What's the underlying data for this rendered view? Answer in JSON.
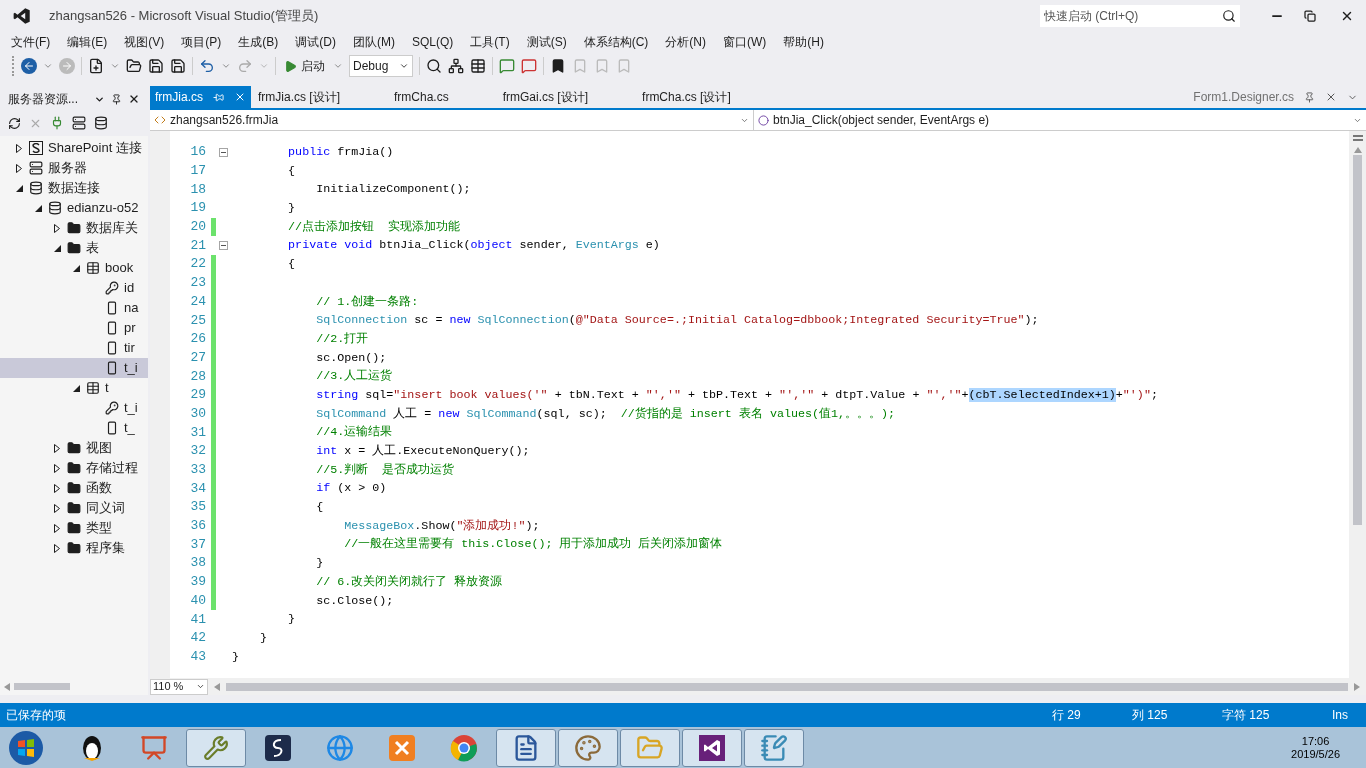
{
  "window": {
    "title": "zhangsan526 - Microsoft Visual Studio(管理员)",
    "quick_launch": {
      "placeholder": "快速启动 (Ctrl+Q)"
    }
  },
  "menu": [
    "文件(F)",
    "编辑(E)",
    "视图(V)",
    "项目(P)",
    "生成(B)",
    "调试(D)",
    "团队(M)",
    "SQL(Q)",
    "工具(T)",
    "测试(S)",
    "体系结构(C)",
    "分析(N)",
    "窗口(W)",
    "帮助(H)"
  ],
  "toolbar": {
    "start_label": "启动",
    "config": "Debug"
  },
  "server_explorer": {
    "title": "服务器资源...",
    "tree": [
      {
        "label": "SharePoint 连接",
        "kind": "sharepoint",
        "expanded": false,
        "selected": false
      },
      {
        "label": "服务器",
        "kind": "server",
        "expanded": false,
        "selected": false
      },
      {
        "label": "数据连接",
        "kind": "dbconn",
        "expanded": true,
        "selected": false,
        "children": [
          {
            "label": "edianzu-o52",
            "kind": "db",
            "expanded": true,
            "selected": false,
            "children": [
              {
                "label": "数据库关",
                "kind": "folder",
                "expanded": false,
                "selected": false
              },
              {
                "label": "表",
                "kind": "folder",
                "expanded": true,
                "selected": false,
                "children": [
                  {
                    "label": "book",
                    "kind": "table",
                    "expanded": true,
                    "selected": false,
                    "children": [
                      {
                        "label": "id",
                        "kind": "key",
                        "selected": false
                      },
                      {
                        "label": "na",
                        "kind": "column",
                        "selected": false
                      },
                      {
                        "label": "pr",
                        "kind": "column",
                        "selected": false
                      },
                      {
                        "label": "tir",
                        "kind": "column",
                        "selected": false
                      },
                      {
                        "label": "t_i",
                        "kind": "column",
                        "selected": true
                      }
                    ]
                  },
                  {
                    "label": "t",
                    "kind": "table",
                    "expanded": true,
                    "selected": false,
                    "children": [
                      {
                        "label": "t_i",
                        "kind": "key",
                        "selected": false
                      },
                      {
                        "label": "t_",
                        "kind": "column",
                        "selected": false
                      }
                    ]
                  }
                ]
              },
              {
                "label": "视图",
                "kind": "folder",
                "expanded": false,
                "selected": false
              },
              {
                "label": "存储过程",
                "kind": "folder",
                "expanded": false,
                "selected": false
              },
              {
                "label": "函数",
                "kind": "folder",
                "expanded": false,
                "selected": false
              },
              {
                "label": "同义词",
                "kind": "folder",
                "expanded": false,
                "selected": false
              },
              {
                "label": "类型",
                "kind": "folder",
                "expanded": false,
                "selected": false
              },
              {
                "label": "程序集",
                "kind": "folder",
                "expanded": false,
                "selected": false
              }
            ]
          }
        ]
      }
    ]
  },
  "tabs": [
    {
      "label": "frmJia.cs",
      "selected": true
    },
    {
      "label": "frmJia.cs [设计]",
      "selected": false
    },
    {
      "label": "frmCha.cs",
      "selected": false
    },
    {
      "label": "frmGai.cs [设计]",
      "selected": false
    },
    {
      "label": "frmCha.cs [设计]",
      "selected": false
    }
  ],
  "preview_tab": "Form1.Designer.cs",
  "nav": {
    "class": "zhangsan526.frmJia",
    "member": "btnJia_Click(object sender, EventArgs e)"
  },
  "code": [
    {
      "n": "16",
      "collapsible": true,
      "changed": false,
      "tokens": [
        {
          "kind": "keyword",
          "text": "        public"
        },
        {
          "kind": "plain",
          "text": " frmJia()"
        }
      ]
    },
    {
      "n": "17",
      "collapsible": false,
      "changed": false,
      "tokens": [
        {
          "kind": "plain",
          "text": "        {"
        }
      ]
    },
    {
      "n": "18",
      "collapsible": false,
      "changed": false,
      "tokens": [
        {
          "kind": "plain",
          "text": "            InitializeComponent();"
        }
      ]
    },
    {
      "n": "19",
      "collapsible": false,
      "changed": false,
      "tokens": [
        {
          "kind": "plain",
          "text": "        }"
        }
      ]
    },
    {
      "n": "20",
      "collapsible": false,
      "changed": true,
      "tokens": [
        {
          "kind": "comment",
          "text": "        //点击添加按钮  实现添加功能"
        }
      ]
    },
    {
      "n": "21",
      "collapsible": true,
      "changed": false,
      "tokens": [
        {
          "kind": "keyword",
          "text": "        private void"
        },
        {
          "kind": "plain",
          "text": " btnJia_Click("
        },
        {
          "kind": "keyword",
          "text": "object"
        },
        {
          "kind": "plain",
          "text": " sender,"
        },
        {
          "kind": "type",
          "text": " EventArgs"
        },
        {
          "kind": "plain",
          "text": " e)"
        }
      ]
    },
    {
      "n": "22",
      "collapsible": false,
      "changed": true,
      "tokens": [
        {
          "kind": "plain",
          "text": "        {"
        }
      ]
    },
    {
      "n": "23",
      "collapsible": false,
      "changed": true
    },
    {
      "n": "24",
      "collapsible": false,
      "changed": true,
      "tokens": [
        {
          "kind": "comment",
          "text": "            // 1.创建一条路:"
        }
      ]
    },
    {
      "n": "25",
      "collapsible": false,
      "changed": true,
      "tokens": [
        {
          "kind": "type",
          "text": "            SqlConnection"
        },
        {
          "kind": "plain",
          "text": " sc ="
        },
        {
          "kind": "keyword",
          "text": " new"
        },
        {
          "kind": "type",
          "text": " SqlConnection"
        },
        {
          "kind": "plain",
          "text": "("
        },
        {
          "kind": "string",
          "text": "@\"Data Source=.;Initial Catalog=dbbook;Integrated Security=True\""
        },
        {
          "kind": "plain",
          "text": ");"
        }
      ]
    },
    {
      "n": "26",
      "collapsible": false,
      "changed": true,
      "tokens": [
        {
          "kind": "comment",
          "text": "            //2.打开"
        }
      ]
    },
    {
      "n": "27",
      "collapsible": false,
      "changed": true,
      "tokens": [
        {
          "kind": "plain",
          "text": "            sc.Open();"
        }
      ]
    },
    {
      "n": "28",
      "collapsible": false,
      "changed": true,
      "tokens": [
        {
          "kind": "comment",
          "text": "            //3.人工运货"
        }
      ]
    },
    {
      "n": "29",
      "collapsible": false,
      "changed": true,
      "tokens": [
        {
          "kind": "keyword",
          "text": "            string"
        },
        {
          "kind": "plain",
          "text": " sql="
        },
        {
          "kind": "string",
          "text": "\"insert book values('\""
        },
        {
          "kind": "plain",
          "text": " + tbN.Text +"
        },
        {
          "kind": "string",
          "text": " \"','\""
        },
        {
          "kind": "plain",
          "text": " + tbP.Text +"
        },
        {
          "kind": "string",
          "text": " \"','\""
        },
        {
          "kind": "plain",
          "text": " + dtpT.Value +"
        },
        {
          "kind": "string",
          "text": " \"','\""
        },
        {
          "kind": "plain",
          "text": "+"
        },
        {
          "kind": "selection",
          "text": "(cbT.SelectedIndex+1)"
        },
        {
          "kind": "plain",
          "text": "+"
        },
        {
          "kind": "string",
          "text": "\"')\""
        },
        {
          "kind": "plain",
          "text": ";"
        }
      ]
    },
    {
      "n": "30",
      "collapsible": false,
      "changed": true,
      "tokens": [
        {
          "kind": "type",
          "text": "            SqlCommand"
        },
        {
          "kind": "plain",
          "text": " 人工 ="
        },
        {
          "kind": "keyword",
          "text": " new"
        },
        {
          "kind": "type",
          "text": " SqlCommand"
        },
        {
          "kind": "plain",
          "text": "(sql, sc);"
        },
        {
          "kind": "comment",
          "text": "  //货指的是 insert 表名 values(值1,。。。);"
        }
      ]
    },
    {
      "n": "31",
      "collapsible": false,
      "changed": true,
      "tokens": [
        {
          "kind": "comment",
          "text": "            //4.运输结果"
        }
      ]
    },
    {
      "n": "32",
      "collapsible": false,
      "changed": true,
      "tokens": [
        {
          "kind": "keyword",
          "text": "            int"
        },
        {
          "kind": "plain",
          "text": " x = 人工.ExecuteNonQuery();"
        }
      ]
    },
    {
      "n": "33",
      "collapsible": false,
      "changed": true,
      "tokens": [
        {
          "kind": "comment",
          "text": "            //5.判断  是否成功运货"
        }
      ]
    },
    {
      "n": "34",
      "collapsible": false,
      "changed": true,
      "tokens": [
        {
          "kind": "keyword",
          "text": "            if"
        },
        {
          "kind": "plain",
          "text": " (x > 0)"
        }
      ]
    },
    {
      "n": "35",
      "collapsible": false,
      "changed": true,
      "tokens": [
        {
          "kind": "plain",
          "text": "            {"
        }
      ]
    },
    {
      "n": "36",
      "collapsible": false,
      "changed": true,
      "tokens": [
        {
          "kind": "type",
          "text": "                MessageBox"
        },
        {
          "kind": "plain",
          "text": ".Show("
        },
        {
          "kind": "string",
          "text": "\"添加成功!\""
        },
        {
          "kind": "plain",
          "text": ");"
        }
      ]
    },
    {
      "n": "37",
      "collapsible": false,
      "changed": true,
      "tokens": [
        {
          "kind": "comment",
          "text": "                //一般在这里需要有 this.Close(); 用于添加成功 后关闭添加窗体"
        }
      ]
    },
    {
      "n": "38",
      "collapsible": false,
      "changed": true,
      "tokens": [
        {
          "kind": "plain",
          "text": "            }"
        }
      ]
    },
    {
      "n": "39",
      "collapsible": false,
      "changed": true,
      "tokens": [
        {
          "kind": "comment",
          "text": "            // 6.改关闭关闭就行了 释放资源"
        }
      ]
    },
    {
      "n": "40",
      "collapsible": false,
      "changed": true,
      "tokens": [
        {
          "kind": "plain",
          "text": "            sc.Close();"
        }
      ]
    },
    {
      "n": "41",
      "collapsible": false,
      "changed": false,
      "tokens": [
        {
          "kind": "plain",
          "text": "        }"
        }
      ]
    },
    {
      "n": "42",
      "collapsible": false,
      "changed": false,
      "tokens": [
        {
          "kind": "plain",
          "text": "    }"
        }
      ]
    },
    {
      "n": "43",
      "collapsible": false,
      "changed": false,
      "tokens": [
        {
          "kind": "plain",
          "text": "}"
        }
      ]
    }
  ],
  "zoom": "110 %",
  "status_bar": {
    "message": "已保存的项",
    "line": "行 29",
    "column": "列 125",
    "char": "字符 125",
    "mode": "Ins"
  },
  "taskbar": {
    "apps": [
      {
        "kind": "penguin",
        "open": false
      },
      {
        "kind": "slides",
        "open": false
      },
      {
        "kind": "tools",
        "open": true
      },
      {
        "kind": "script",
        "open": false
      },
      {
        "kind": "browser",
        "open": false
      },
      {
        "kind": "server",
        "open": false
      },
      {
        "kind": "globe",
        "open": false
      },
      {
        "kind": "document",
        "open": true
      },
      {
        "kind": "palette",
        "open": true
      },
      {
        "kind": "folder",
        "open": true
      },
      {
        "kind": "ide",
        "open": true
      },
      {
        "kind": "notepad",
        "open": true
      }
    ],
    "time": "17:06",
    "date": "2019/5/26"
  }
}
